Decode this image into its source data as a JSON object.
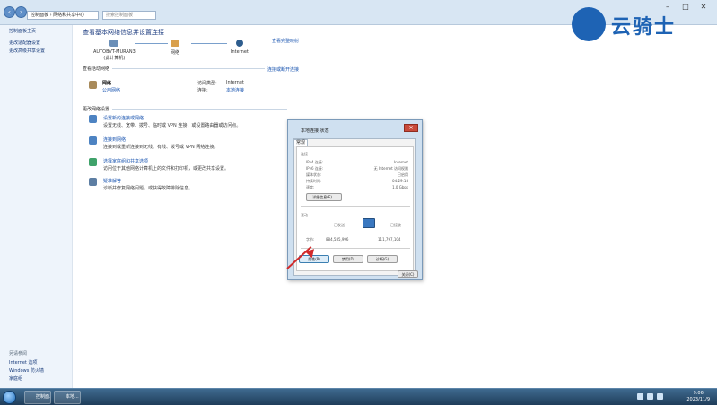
{
  "titlebar": {
    "address": "控制面板 › 网络和共享中心",
    "search_placeholder": "搜索控制面板",
    "minimize": "–",
    "maximize": "□",
    "close": "✕"
  },
  "leftpane": {
    "links": [
      "控制面板主页",
      "更改适配器设置",
      "更改高级共享设置"
    ],
    "see_also": "另请参阅",
    "bottom_links": [
      "Internet 选项",
      "Windows 防火墙",
      "家庭组"
    ]
  },
  "main": {
    "title": "查看基本网络信息并设置连接",
    "view_full_map": "查看完整映射",
    "nodes": [
      {
        "label": "AUTOBVT-MURAN3",
        "sub": "(此计算机)"
      },
      {
        "label": "网络",
        "sub": ""
      },
      {
        "label": "Internet",
        "sub": ""
      }
    ],
    "active_networks_heading": "查看活动网络",
    "connect_disconnect": "连接或断开连接",
    "network": {
      "name": "网络",
      "type": "公用网络",
      "access_label": "访问类型:",
      "access_value": "Internet",
      "connections_label": "连接:",
      "connections_value": "本地连接"
    },
    "change_settings_heading": "更改网络设置",
    "tasks": [
      {
        "title": "设置新的连接或网络",
        "desc": "设置无线、宽带、拨号、临时或 VPN 连接；或设置路由器或访问点。"
      },
      {
        "title": "连接到网络",
        "desc": "连接到或重新连接到无线、有线、拨号或 VPN 网络连接。"
      },
      {
        "title": "选择家庭组和共享选项",
        "desc": "访问位于其他网络计算机上的文件和打印机，或更改共享设置。"
      },
      {
        "title": "疑难解答",
        "desc": "诊断并修复网络问题，或获得故障排除信息。"
      }
    ]
  },
  "dialog": {
    "title": "本地连接 状态",
    "tab": "常规",
    "connection_heading": "连接",
    "rows": [
      {
        "label": "IPv4 连接:",
        "value": "Internet"
      },
      {
        "label": "IPv6 连接:",
        "value": "无 Internet 访问权限"
      },
      {
        "label": "媒体状态:",
        "value": "已启用"
      },
      {
        "label": "持续时间:",
        "value": "04:29:18"
      },
      {
        "label": "速度:",
        "value": "1.0 Gbps"
      }
    ],
    "details_button": "详细信息(E)...",
    "activity_heading": "活动",
    "sent_label": "已发送",
    "received_label": "已接收",
    "bytes_label": "字节:",
    "bytes_sent": "884,585,996",
    "bytes_received": "111,797,104",
    "properties_button": "属性(P)",
    "disable_button": "禁用(D)",
    "diagnose_button": "诊断(G)",
    "close_button": "关闭(C)"
  },
  "watermark": {
    "text": "云骑士"
  },
  "taskbar": {
    "items": [
      "控制面...",
      "本地..."
    ],
    "time": "9:06",
    "date": "2023/11/9"
  },
  "colors": {
    "link": "#1a55b0",
    "accent": "#1e63b4",
    "annotation": "#d22a2a"
  }
}
